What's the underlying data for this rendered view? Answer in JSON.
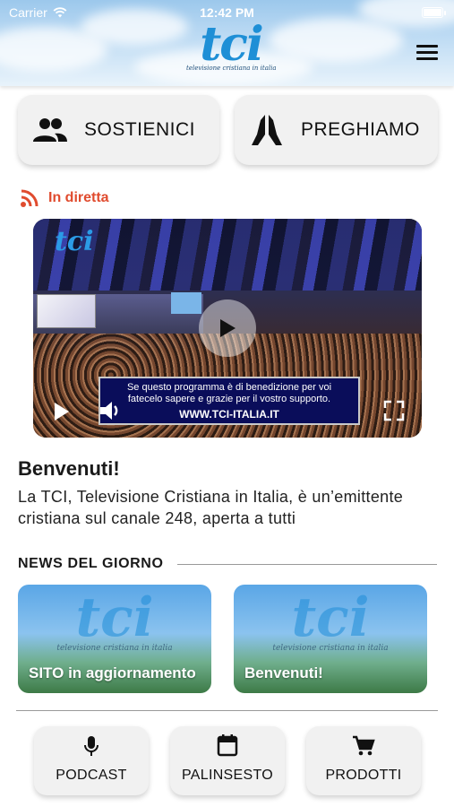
{
  "status_bar": {
    "carrier": "Carrier",
    "time": "12:42 PM"
  },
  "header": {
    "logo_text": "tci",
    "logo_subtitle": "televisione cristiana in italia",
    "menu_icon": "hamburger-menu-icon"
  },
  "actions": [
    {
      "label": "SOSTIENICI",
      "icon": "people-icon"
    },
    {
      "label": "PREGHIAMO",
      "icon": "praying-hands-icon"
    }
  ],
  "live": {
    "label": "In diretta",
    "icon": "rss-feed-icon",
    "color": "#e04b2e"
  },
  "video": {
    "logo_text": "tci",
    "banner_line1": "Se questo programma è di benedizione per voi",
    "banner_line2": "fatecelo sapere e grazie per il vostro supporto.",
    "banner_url": "WWW.TCI-ITALIA.IT"
  },
  "welcome": {
    "title": "Benvenuti!",
    "body": "La TCI, Televisione Cristiana in Italia, è un’emittente cristiana sul canale 248, aperta a tutti"
  },
  "news": {
    "heading": "NEWS DEL GIORNO",
    "items": [
      {
        "title": "SITO in aggiornamento",
        "logo_text": "tci",
        "logo_subtitle": "televisione cristiana in italia"
      },
      {
        "title": "Benvenuti!",
        "logo_text": "tci",
        "logo_subtitle": "televisione cristiana in italia"
      }
    ]
  },
  "bottom_nav": [
    {
      "label": "PODCAST",
      "icon": "microphone-icon"
    },
    {
      "label": "PALINSESTO",
      "icon": "calendar-icon"
    },
    {
      "label": "PRODOTTI",
      "icon": "shopping-cart-icon"
    }
  ]
}
